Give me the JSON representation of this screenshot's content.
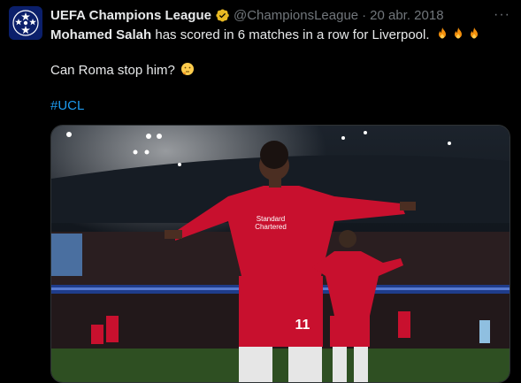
{
  "tweet": {
    "author_name": "UEFA Champions League",
    "handle": "@ChampionsLeague",
    "separator": "·",
    "date": "20 abr. 2018",
    "more_label": "···",
    "line1_bold": "Mohamed Salah",
    "line1_rest": " has scored in 6 matches in a row for Liverpool.",
    "line2": "Can Roma stop him?",
    "hashtag": "#UCL"
  },
  "media": {
    "jersey_text_1": "Standard",
    "jersey_text_2": "Chartered",
    "jersey_number": "11"
  },
  "colors": {
    "background": "#000000",
    "text": "#e7e9ea",
    "muted": "#71767b",
    "link": "#1d9bf0",
    "verified_gold": "#e8b923",
    "ucl_blue": "#0b1f6b",
    "liverpool_red": "#c8102e"
  },
  "icons": [
    "champions-league-logo-icon",
    "verified-badge-icon",
    "fire-emoji-icon",
    "thinking-face-emoji-icon",
    "more-icon"
  ]
}
